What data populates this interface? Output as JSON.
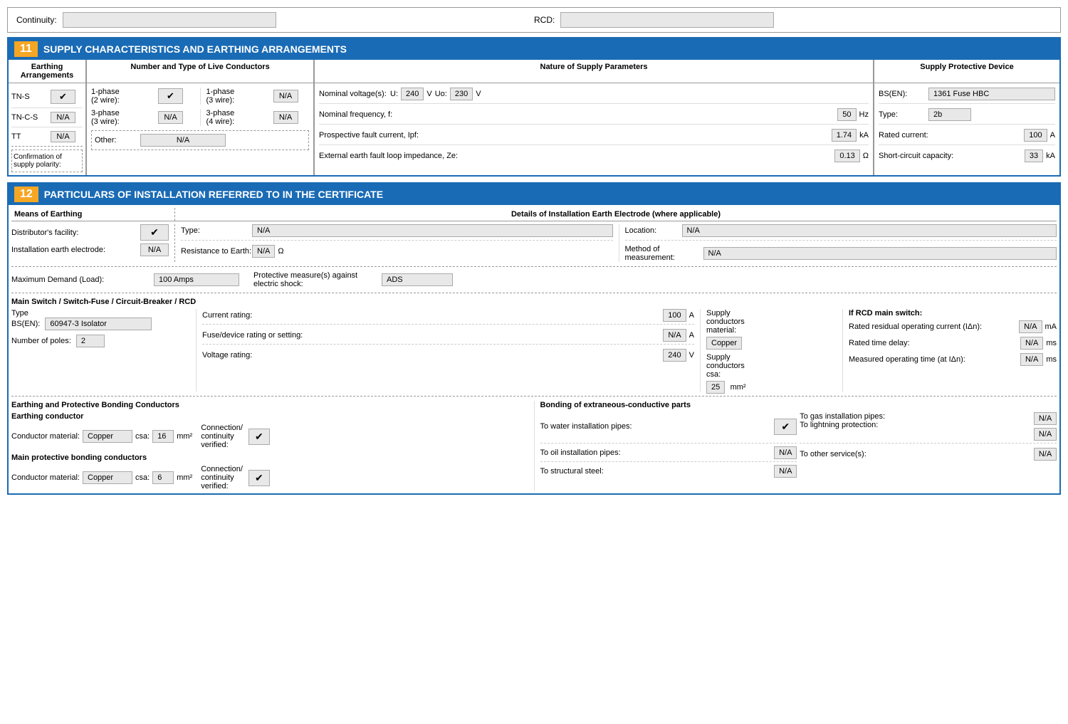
{
  "top": {
    "continuity_label": "Continuity:",
    "continuity_value": "",
    "rcd_label": "RCD:",
    "rcd_value": ""
  },
  "section11": {
    "number": "11",
    "title": "SUPPLY CHARACTERISTICS AND EARTHING ARRANGEMENTS",
    "earthing": {
      "header": "Earthing Arrangements",
      "rows": [
        {
          "label": "TN-S",
          "value": "✔"
        },
        {
          "label": "TN-C-S",
          "value": "N/A"
        },
        {
          "label": "TT",
          "value": "N/A"
        }
      ],
      "confirmation_label": "Confirmation of supply polarity:"
    },
    "live": {
      "header": "Number and Type of Live Conductors",
      "rows": [
        {
          "label1": "1-phase (2 wire):",
          "val1": "✔",
          "label2": "1-phase (3 wire):",
          "val2": "N/A"
        },
        {
          "label1": "3-phase (3 wire):",
          "val1": "N/A",
          "label2": "3-phase (4 wire):",
          "val2": "N/A"
        },
        {
          "label1": "Other:",
          "val1": "",
          "label2": "",
          "val2": "N/A"
        }
      ]
    },
    "nature": {
      "header": "Nature of Supply Parameters",
      "nominal_voltage_label": "Nominal voltage(s):",
      "u_label": "U:",
      "u_value": "240",
      "u_unit": "V",
      "uo_label": "Uo:",
      "uo_value": "230",
      "uo_unit": "V",
      "freq_label": "Nominal frequency, f:",
      "freq_value": "50",
      "freq_unit": "Hz",
      "pfc_label": "Prospective fault current, Ipf:",
      "pfc_value": "1.74",
      "pfc_unit": "kA",
      "eefli_label": "External earth fault loop impedance, Ze:",
      "eefli_value": "0.13",
      "eefli_unit": "Ω"
    },
    "protective": {
      "header": "Supply Protective Device",
      "bs_label": "BS(EN):",
      "bs_value": "1361 Fuse HBC",
      "type_label": "Type:",
      "type_value": "2b",
      "rated_label": "Rated current:",
      "rated_value": "100",
      "rated_unit": "A",
      "sc_label": "Short-circuit capacity:",
      "sc_value": "33",
      "sc_unit": "kA"
    }
  },
  "section12": {
    "number": "12",
    "title": "PARTICULARS OF INSTALLATION REFERRED TO IN THE CERTIFICATE",
    "earthing_header": "Means of Earthing",
    "electrode_header": "Details of Installation Earth Electrode (where applicable)",
    "distributor_label": "Distributor's facility:",
    "distributor_value": "✔",
    "installation_label": "Installation earth electrode:",
    "installation_value": "N/A",
    "type_label": "Type:",
    "type_value": "N/A",
    "location_label": "Location:",
    "location_value": "N/A",
    "resistance_label": "Resistance to Earth:",
    "resistance_value": "N/A",
    "resistance_unit": "Ω",
    "method_label": "Method of measurement:",
    "method_value": "N/A",
    "max_demand_label": "Maximum Demand (Load):",
    "max_demand_value": "100 Amps",
    "protective_label": "Protective measure(s) against electric shock:",
    "protective_value": "ADS",
    "main_switch_header": "Main Switch / Switch-Fuse / Circuit-Breaker / RCD",
    "type_bs_label": "Type BS(EN):",
    "type_bs_value": "60947-3 Isolator",
    "current_rating_label": "Current rating:",
    "current_rating_value": "100",
    "current_rating_unit": "A",
    "fuse_rating_label": "Fuse/device rating or setting:",
    "fuse_rating_value": "N/A",
    "fuse_rating_unit": "A",
    "voltage_rating_label": "Voltage rating:",
    "voltage_rating_value": "240",
    "voltage_rating_unit": "V",
    "number_poles_label": "Number of poles:",
    "number_poles_value": "2",
    "supply_conductors_label": "Supply conductors material:",
    "supply_conductors_value": "Copper",
    "supply_csa_label": "Supply conductors csa:",
    "supply_csa_value": "25",
    "supply_csa_unit": "mm²",
    "rcd_header": "If RCD main switch:",
    "rated_residual_label": "Rated residual operating current (IΔn):",
    "rated_residual_value": "N/A",
    "rated_residual_unit": "mA",
    "rated_time_label": "Rated time delay:",
    "rated_time_value": "N/A",
    "rated_time_unit": "ms",
    "measured_op_label": "Measured operating time (at IΔn):",
    "measured_op_value": "N/A",
    "measured_op_unit": "ms",
    "earthing_bonding_header": "Earthing and Protective Bonding Conductors",
    "earthing_conductor_header": "Earthing conductor",
    "ec_conductor_label": "Conductor material:",
    "ec_conductor_value": "Copper",
    "ec_csa_label": "csa:",
    "ec_csa_value": "16",
    "ec_csa_unit": "mm²",
    "ec_connection_label": "Connection/ continuity verified:",
    "ec_connection_value": "✔",
    "main_bonding_header": "Main protective bonding conductors",
    "mbc_conductor_label": "Conductor material:",
    "mbc_conductor_value": "Copper",
    "mbc_csa_label": "csa:",
    "mbc_csa_value": "6",
    "mbc_csa_unit": "mm²",
    "mbc_connection_label": "Connection/ continuity verified:",
    "mbc_connection_value": "✔",
    "bonding_ext_header": "Bonding of extraneous-conductive parts",
    "water_label": "To water installation pipes:",
    "water_value": "✔",
    "gas_label": "To gas installation pipes:",
    "gas_value": "N/A",
    "oil_label": "To oil installation pipes:",
    "oil_value": "N/A",
    "lightning_label": "To lightning protection:",
    "lightning_value": "N/A",
    "structural_label": "To structural steel:",
    "structural_value": "N/A",
    "other_label": "To other service(s):",
    "other_value": "N/A"
  }
}
